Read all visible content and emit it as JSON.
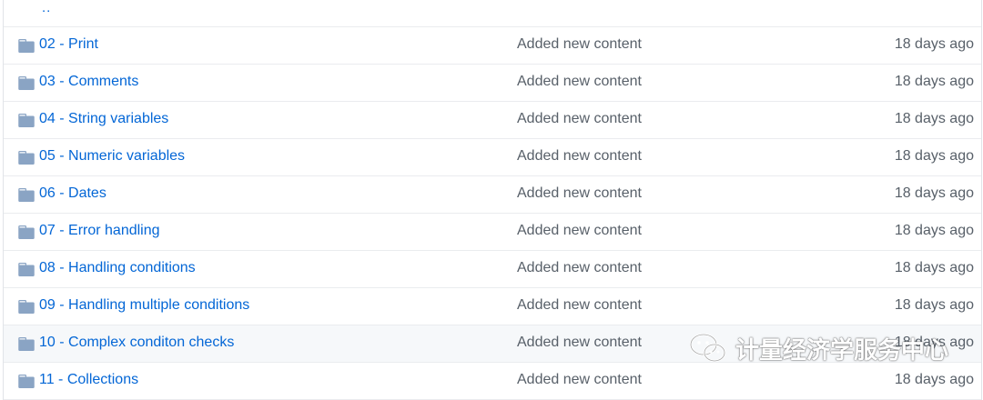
{
  "parent_link": "..",
  "colors": {
    "link": "#0366d6",
    "folder_icon": "#79b8ff",
    "muted": "#586069"
  },
  "rows": [
    {
      "name": "02 - Print",
      "message": "Added new content",
      "age": "18 days ago",
      "icon": "folder-icon"
    },
    {
      "name": "03 - Comments",
      "message": "Added new content",
      "age": "18 days ago",
      "icon": "folder-icon"
    },
    {
      "name": "04 - String variables",
      "message": "Added new content",
      "age": "18 days ago",
      "icon": "folder-icon"
    },
    {
      "name": "05 - Numeric variables",
      "message": "Added new content",
      "age": "18 days ago",
      "icon": "folder-icon"
    },
    {
      "name": "06 - Dates",
      "message": "Added new content",
      "age": "18 days ago",
      "icon": "folder-icon"
    },
    {
      "name": "07 - Error handling",
      "message": "Added new content",
      "age": "18 days ago",
      "icon": "folder-icon"
    },
    {
      "name": "08 - Handling conditions",
      "message": "Added new content",
      "age": "18 days ago",
      "icon": "folder-icon"
    },
    {
      "name": "09 - Handling multiple conditions",
      "message": "Added new content",
      "age": "18 days ago",
      "icon": "folder-icon"
    },
    {
      "name": "10 - Complex conditon checks",
      "message": "Added new content",
      "age": "18 days ago",
      "icon": "folder-icon"
    },
    {
      "name": "11 - Collections",
      "message": "Added new content",
      "age": "18 days ago",
      "icon": "folder-icon"
    }
  ],
  "watermark": {
    "text": "计量经济学服务中心",
    "icon": "wechat-icon"
  }
}
